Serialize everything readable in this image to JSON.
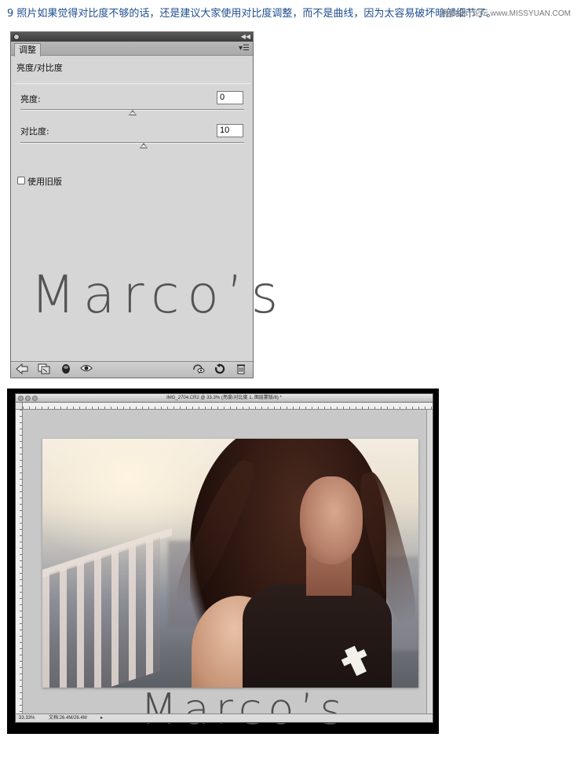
{
  "heading": {
    "text": "9 照片如果觉得对比度不够的话，还是建议大家使用对比度调整，而不是曲线，因为太容易破坏暗部细节了。",
    "site_watermark": "思缘设计论坛 www.MISSYUAN.COM"
  },
  "panel": {
    "tab_label": "调整",
    "collapse_icon": "double-chevron-icon",
    "menu_icon": "panel-menu-icon",
    "adjustment_title": "亮度/对比度",
    "brightness": {
      "label": "亮度:",
      "value": "0",
      "slider_fraction": 0.5
    },
    "contrast": {
      "label": "对比度:",
      "value": "10",
      "slider_fraction": 0.55
    },
    "legacy": {
      "label": "使用旧版",
      "checked": false
    },
    "watermark": "Marco’s",
    "bottom_icons": [
      "back-arrow-icon",
      "clip-to-layer-icon",
      "layer-mask-icon",
      "visibility-eye-icon",
      "previous-state-icon",
      "reset-icon",
      "trash-icon"
    ]
  },
  "document": {
    "title": "IMG_2704.CR2 @ 33.3% (亮度/对比度 1, 图层蒙版/8) *",
    "zoom": "33.33%",
    "doc_size": "文档:26.4M/26.4M",
    "watermark": "Marco’s"
  },
  "colors": {
    "heading": "#1f4e8f",
    "panel_bg": "#d6d6d6",
    "canvas_bg": "#c8c8c8"
  }
}
